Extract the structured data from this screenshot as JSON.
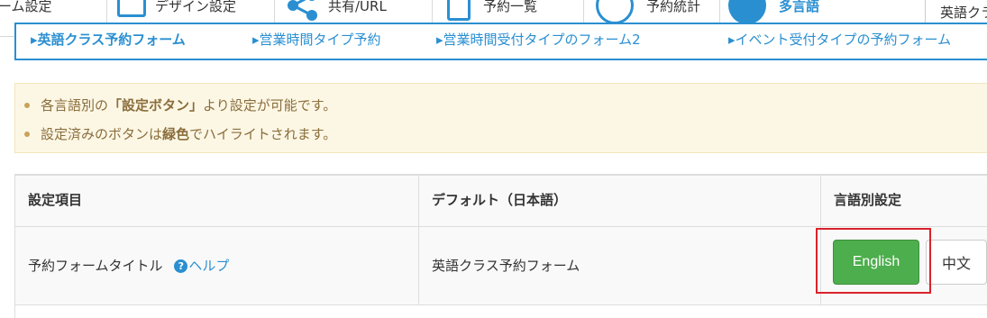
{
  "toolbar": {
    "items": [
      {
        "label": "ーム設定"
      },
      {
        "label": "デザイン設定"
      },
      {
        "label": "共有/URL"
      },
      {
        "label": "予約一覧"
      },
      {
        "label": "予約統計"
      },
      {
        "label": "多言語"
      }
    ],
    "language_select": "英語クラス予約フォーム"
  },
  "form_tabs": [
    {
      "label": "英語クラス予約フォーム",
      "active": true
    },
    {
      "label": "営業時間タイプ予約",
      "active": false
    },
    {
      "label": "営業時間受付タイプのフォーム2",
      "active": false
    },
    {
      "label": "イベント受付タイプの予約フォーム",
      "active": false
    }
  ],
  "notice": {
    "line1": {
      "pre": "各言語別の",
      "bold": "「設定ボタン」",
      "post": "より設定が可能です。"
    },
    "line2": {
      "pre": "設定済みのボタンは",
      "bold": "緑色",
      "post": "でハイライトされます。"
    }
  },
  "table": {
    "headers": {
      "item": "設定項目",
      "default": "デフォルト（日本語）",
      "lang": "言語別設定"
    },
    "rows": [
      {
        "item": "予約フォームタイトル",
        "help": "ヘルプ",
        "default": "英語クラス予約フォーム",
        "buttons": {
          "english": "English",
          "chinese": "中文"
        }
      }
    ]
  },
  "icons": {
    "help": "question-circle-icon",
    "tab_marker": "caret-right-icon"
  },
  "colors": {
    "accent": "#2a8fd1",
    "success": "#4cae4c",
    "highlight": "#d9232a",
    "notice_bg": "#fcf7e5"
  }
}
